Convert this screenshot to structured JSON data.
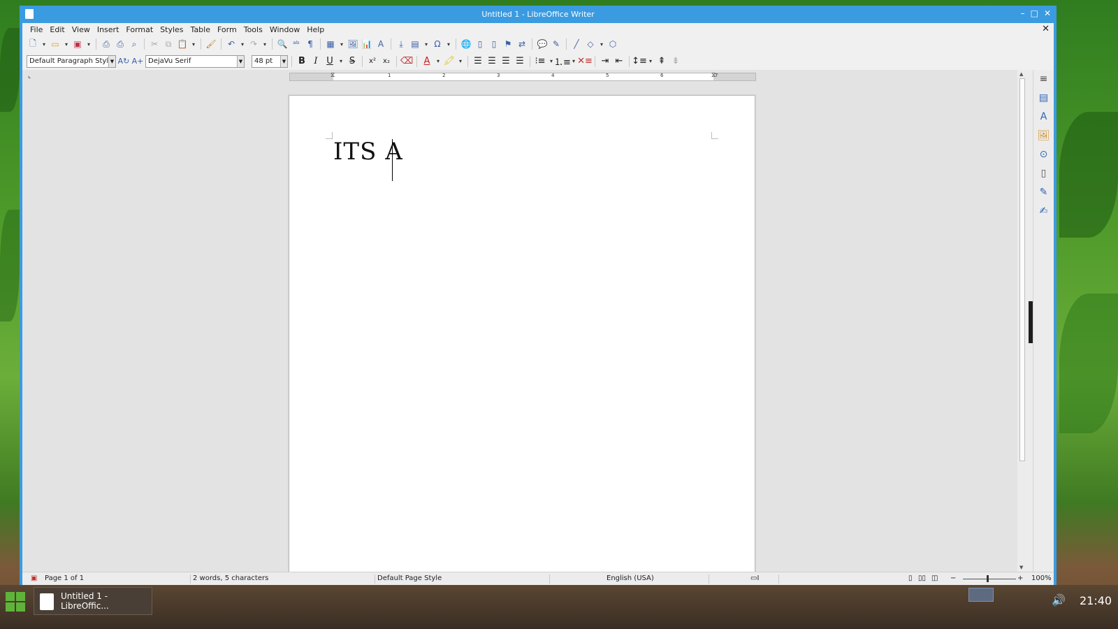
{
  "window": {
    "title": "Untitled 1 - LibreOffice Writer"
  },
  "menubar": [
    "File",
    "Edit",
    "View",
    "Insert",
    "Format",
    "Styles",
    "Table",
    "Form",
    "Tools",
    "Window",
    "Help"
  ],
  "format_toolbar": {
    "paragraph_style": "Default Paragraph Style",
    "font_name": "DejaVu Serif",
    "font_size": "48 pt"
  },
  "ruler": {
    "labels": [
      "1",
      "2",
      "3",
      "4",
      "5",
      "6",
      "7"
    ]
  },
  "document": {
    "text": "ITS A"
  },
  "statusbar": {
    "page": "Page 1 of 1",
    "word_count": "2 words, 5 characters",
    "page_style": "Default Page Style",
    "language": "English (USA)",
    "zoom": "100%"
  },
  "taskbar": {
    "task_label": "Untitled 1 - LibreOffic...",
    "clock": "21:40"
  },
  "colors": {
    "accent": "#3b9be0"
  }
}
